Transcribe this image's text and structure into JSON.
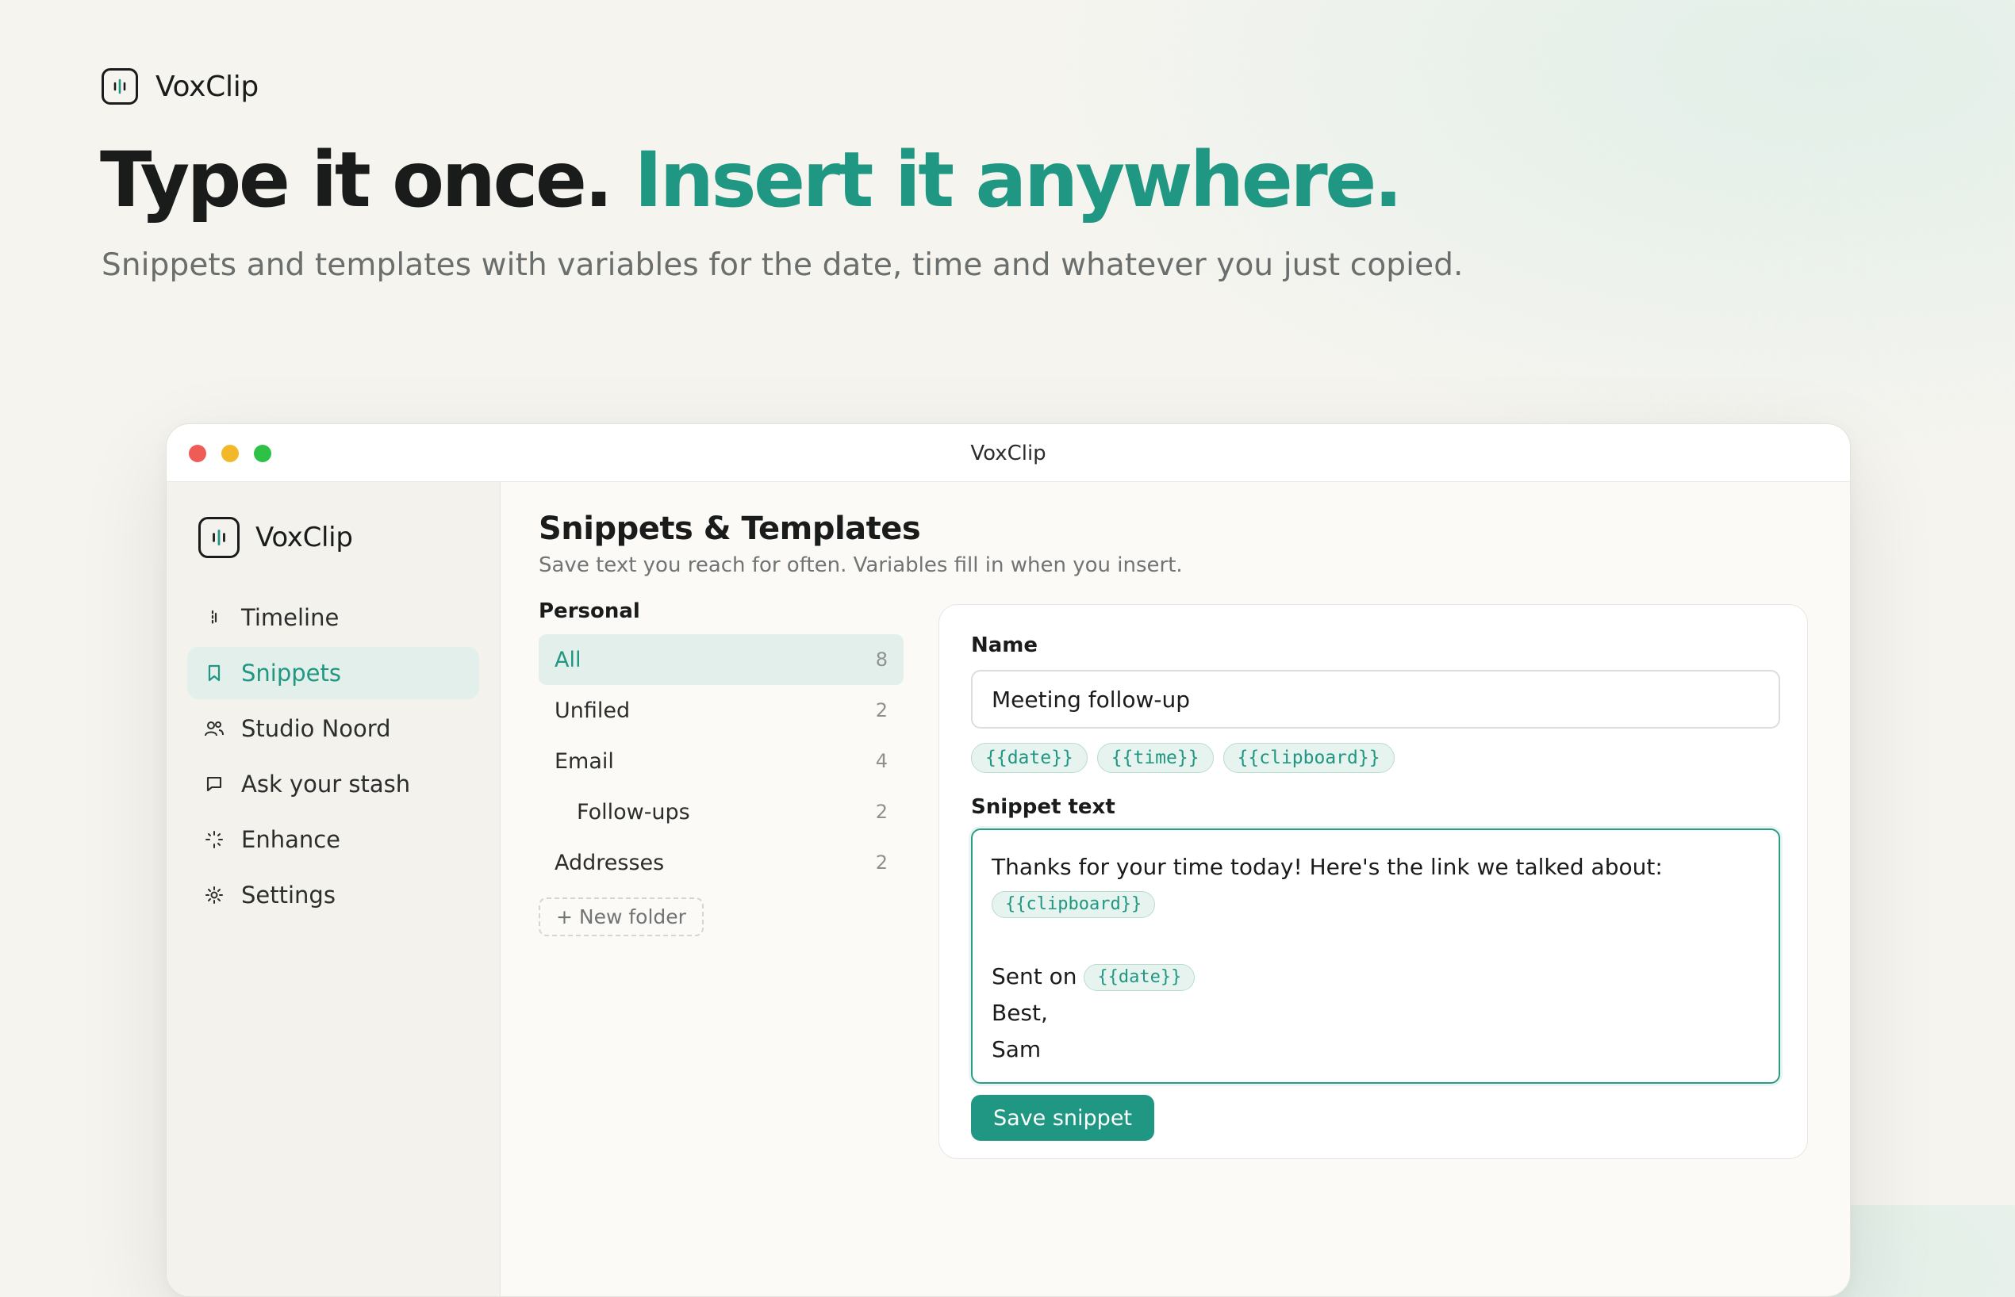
{
  "brand": {
    "name": "VoxClip",
    "icon": "waveform-logo-icon"
  },
  "hero": {
    "title_main": "Type it once.",
    "title_accent": "Insert it anywhere.",
    "subtitle": "Snippets and templates with variables for the date, time and whatever you just copied."
  },
  "window": {
    "title": "VoxClip"
  },
  "sidebar": {
    "brand_name": "VoxClip",
    "items": [
      {
        "label": "Timeline",
        "icon": "timeline-icon",
        "active": false
      },
      {
        "label": "Snippets",
        "icon": "bookmark-icon",
        "active": true
      },
      {
        "label": "Studio Noord",
        "icon": "users-icon",
        "active": false
      },
      {
        "label": "Ask your stash",
        "icon": "chat-bubble-icon",
        "active": false
      },
      {
        "label": "Enhance",
        "icon": "sparkle-icon",
        "active": false
      },
      {
        "label": "Settings",
        "icon": "gear-icon",
        "active": false
      }
    ]
  },
  "main": {
    "title": "Snippets & Templates",
    "subtitle": "Save text you reach for often. Variables fill in when you insert."
  },
  "folders": {
    "heading": "Personal",
    "items": [
      {
        "label": "All",
        "count": "8",
        "active": true,
        "indent": false
      },
      {
        "label": "Unfiled",
        "count": "2",
        "active": false,
        "indent": false
      },
      {
        "label": "Email",
        "count": "4",
        "active": false,
        "indent": false
      },
      {
        "label": "Follow-ups",
        "count": "2",
        "active": false,
        "indent": true
      },
      {
        "label": "Addresses",
        "count": "2",
        "active": false,
        "indent": false
      }
    ],
    "new_folder_label": "+ New folder"
  },
  "editor": {
    "name_label": "Name",
    "name_value": "Meeting follow-up",
    "variables": [
      "{{date}}",
      "{{time}}",
      "{{clipboard}}"
    ],
    "text_label": "Snippet text",
    "text": {
      "line1": "Thanks for your time today! Here's the link we talked about:",
      "line1_var": "{{clipboard}}",
      "line3_prefix": "Sent on",
      "line3_var": "{{date}}",
      "line4": "Best,",
      "line5": "Sam"
    },
    "save_label": "Save snippet"
  },
  "colors": {
    "accent": "#1f9782",
    "accent_soft": "#e2efea",
    "text": "#1a1c1b",
    "muted": "#707472"
  }
}
